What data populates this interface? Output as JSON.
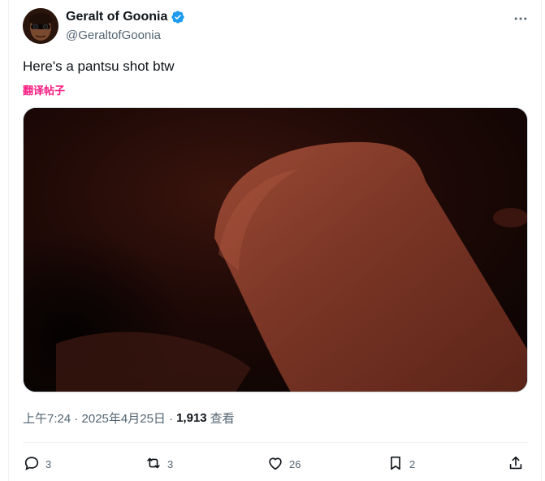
{
  "author": {
    "display_name": "Geralt of Goonia",
    "handle": "@GeraltofGoonia",
    "verified": true
  },
  "tweet": {
    "text": "Here's a pantsu shot btw",
    "translate_label": "翻译帖子"
  },
  "meta": {
    "timestamp": "上午7:24 · 2025年4月25日 · ",
    "views_count": "1,913",
    "views_label": "查看"
  },
  "actions": {
    "reply_count": "3",
    "repost_count": "3",
    "like_count": "26",
    "bookmark_count": "2"
  },
  "colors": {
    "verified": "#1d9bf0",
    "translate": "#f91880",
    "secondary_text": "#536471"
  },
  "icons": [
    "verified-badge-icon",
    "more-icon",
    "reply-icon",
    "repost-icon",
    "like-icon",
    "bookmark-icon",
    "share-icon"
  ]
}
